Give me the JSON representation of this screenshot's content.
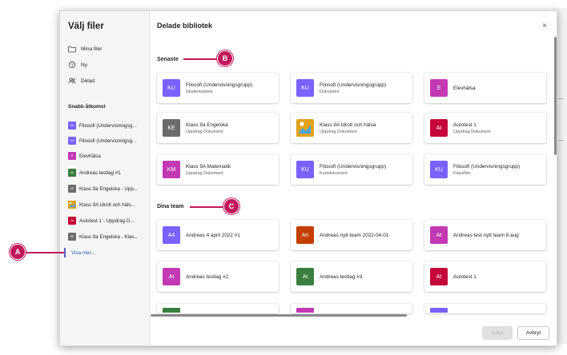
{
  "sidebar": {
    "title": "Välj filer",
    "nav": [
      {
        "label": "Mina filer",
        "icon": "folder-icon"
      },
      {
        "label": "Ny",
        "icon": "recent-clock-icon"
      },
      {
        "label": "Delad",
        "icon": "people-icon"
      }
    ],
    "quick_access_label": "Snabb åtkomst",
    "quick_access": [
      {
        "label": "Filosofi (Undervisningsg...",
        "color": "#7b61ff",
        "initials": "KU"
      },
      {
        "label": "Filosofi (Undervisningsg...",
        "color": "#7b61ff",
        "initials": "KU"
      },
      {
        "label": "Elevhälsa",
        "color": "#c239b3",
        "initials": "E"
      },
      {
        "label": "Andreas testlag #1",
        "color": "#3a7f3f",
        "initials": "At"
      },
      {
        "label": "Klass 9a Engelska - Upp...",
        "color": "#6b6b6b",
        "initials": "KE"
      },
      {
        "label": "Klass 9A Idrott och häls...",
        "color": "#e3a21a",
        "initials": ""
      },
      {
        "label": "Autotest 1 - Uppdrag D...",
        "color": "#c4063a",
        "initials": "At"
      },
      {
        "label": "Klass 9a Engelska - Klas...",
        "color": "#6b6b6b",
        "initials": "KE"
      }
    ],
    "show_more": "Visa mer..."
  },
  "main": {
    "title": "Delade bibliotek",
    "close_glyph": "×",
    "recent_heading": "Senaste",
    "recent": [
      {
        "initials": "KU",
        "name": "Filosofi (Undervisningsgrupp)",
        "sub": "Studentarbete",
        "color": "#7b61ff"
      },
      {
        "initials": "KU",
        "name": "Filosofi (Undervisningsgrupp)",
        "sub": "Dokument",
        "color": "#7b61ff"
      },
      {
        "initials": "E",
        "name": "Elevhälsa",
        "sub": "",
        "color": "#c239b3"
      },
      {
        "initials": "KE",
        "name": "Klass 9a Engelska",
        "sub": "Uppdrag Dokument",
        "color": "#6b6b6b"
      },
      {
        "initials": "",
        "name": "Klass 9A Idrott och hälsa",
        "sub": "Uppdrag Dokument",
        "color": "#e3a21a"
      },
      {
        "initials": "At",
        "name": "Autotest 1",
        "sub": "Uppdrag Dokument",
        "color": "#c4063a"
      },
      {
        "initials": "KM",
        "name": "Klass 9A Matematik",
        "sub": "Uppdrag Dokument",
        "color": "#c239b3"
      },
      {
        "initials": "KU",
        "name": "Filosofi (Undervisningsgrupp)",
        "sub": "Kursdokument",
        "color": "#7b61ff"
      },
      {
        "initials": "KU",
        "name": "Filosofi (Undervisningsgrupp)",
        "sub": "Klassfiler",
        "color": "#7b61ff"
      }
    ],
    "teams_heading": "Dina team",
    "teams": [
      {
        "initials": "A4",
        "name": "Andreas 4 april 2022 #1",
        "color": "#7b61ff"
      },
      {
        "initials": "An",
        "name": "Andreas nytt team 2022-04-01",
        "color": "#c43e00"
      },
      {
        "initials": "At",
        "name": "Andreas test nytt team 8 aug",
        "color": "#c239b3"
      },
      {
        "initials": "At",
        "name": "Andreas testlag #2",
        "color": "#c239b3"
      },
      {
        "initials": "At",
        "name": "Andreas testlag #3",
        "color": "#3a7f3f"
      },
      {
        "initials": "At",
        "name": "Autotest 1",
        "color": "#c4063a"
      },
      {
        "initials": "",
        "name": "",
        "color": "#3a7f3f"
      },
      {
        "initials": "",
        "name": "",
        "color": "#c239b3"
      },
      {
        "initials": "",
        "name": "",
        "color": "#7b61ff"
      }
    ]
  },
  "footer": {
    "select_label": "Välja",
    "cancel_label": "Avbryt"
  },
  "callouts": {
    "a": "A",
    "b": "B",
    "c": "C"
  },
  "accent_color": "#c2185b"
}
